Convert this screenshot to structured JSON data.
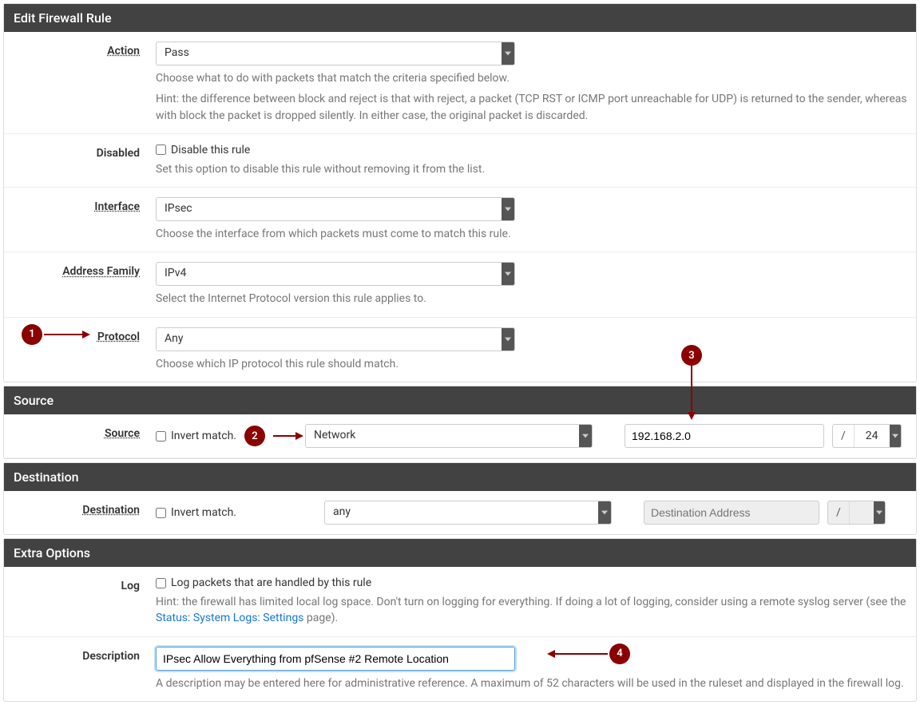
{
  "panels": {
    "edit": {
      "title": "Edit Firewall Rule"
    },
    "source": {
      "title": "Source"
    },
    "destination": {
      "title": "Destination"
    },
    "extra": {
      "title": "Extra Options"
    }
  },
  "action": {
    "label": "Action",
    "value": "Pass",
    "help1": "Choose what to do with packets that match the criteria specified below.",
    "help2": "Hint: the difference between block and reject is that with reject, a packet (TCP RST or ICMP port unreachable for UDP) is returned to the sender, whereas with block the packet is dropped silently. In either case, the original packet is discarded."
  },
  "disabled": {
    "label": "Disabled",
    "checkbox": "Disable this rule",
    "help": "Set this option to disable this rule without removing it from the list."
  },
  "interface": {
    "label": "Interface",
    "value": "IPsec",
    "help": "Choose the interface from which packets must come to match this rule."
  },
  "address_family": {
    "label": "Address Family",
    "value": "IPv4",
    "help": "Select the Internet Protocol version this rule applies to."
  },
  "protocol": {
    "label": "Protocol",
    "value": "Any",
    "help": "Choose which IP protocol this rule should match."
  },
  "source": {
    "label": "Source",
    "invert": "Invert match.",
    "type": "Network",
    "address": "192.168.2.0",
    "slash": "/",
    "mask": "24"
  },
  "destination": {
    "label": "Destination",
    "invert": "Invert match.",
    "type": "any",
    "placeholder": "Destination Address",
    "slash": "/"
  },
  "log": {
    "label": "Log",
    "checkbox": "Log packets that are handled by this rule",
    "help_pre": "Hint: the firewall has limited local log space. Don't turn on logging for everything. If doing a lot of logging, consider using a remote syslog server (see the ",
    "help_link": "Status: System Logs: Settings",
    "help_post": " page)."
  },
  "description": {
    "label": "Description",
    "value": "IPsec Allow Everything from pfSense #2 Remote Location",
    "help": "A description may be entered here for administrative reference. A maximum of 52 characters will be used in the ruleset and displayed in the firewall log."
  },
  "callouts": {
    "c1": "1",
    "c2": "2",
    "c3": "3",
    "c4": "4"
  }
}
